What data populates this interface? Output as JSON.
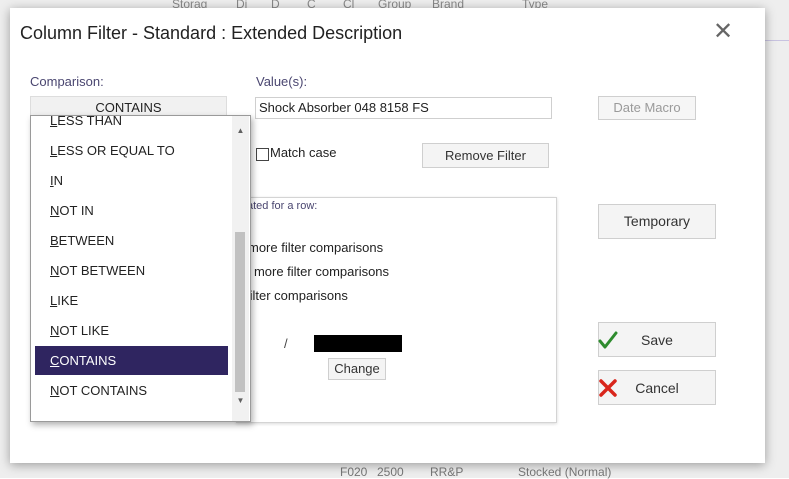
{
  "background": {
    "headers": [
      "Storag",
      "Di",
      "D",
      "C",
      "Cl",
      "Group",
      "Brand",
      "Type"
    ],
    "row": [
      "F020",
      "2500",
      "RR&P",
      "Stocked (Normal)"
    ]
  },
  "dialog": {
    "title": "Column Filter - Standard : Extended Description",
    "close_glyph": "✕"
  },
  "comparison": {
    "label": "Comparison:",
    "selected": "CONTAINS"
  },
  "values": {
    "label": "Value(s):",
    "value": "Shock Absorber 048 8158 FS"
  },
  "buttons": {
    "date_macro": "Date Macro",
    "remove_filter": "Remove Filter",
    "temporary": "Temporary",
    "save": "Save",
    "cancel": "Cancel",
    "change": "Change"
  },
  "match_case": {
    "label": "Match case",
    "checked": false
  },
  "group": {
    "legend": "ated for a row:",
    "options": [
      " more filter comparisons",
      "r more filter comparisons",
      "filter comparisons"
    ],
    "slash": "/"
  },
  "dropdown": {
    "items": [
      {
        "accel": "L",
        "rest": "ESS THAN"
      },
      {
        "accel": "L",
        "rest": "ESS OR EQUAL TO"
      },
      {
        "accel": "I",
        "rest": "N"
      },
      {
        "accel": "N",
        "rest": "OT IN"
      },
      {
        "accel": "B",
        "rest": "ETWEEN"
      },
      {
        "accel": "N",
        "rest": "OT BETWEEN"
      },
      {
        "accel": "L",
        "rest": "IKE"
      },
      {
        "accel": "N",
        "rest": "OT LIKE"
      },
      {
        "accel": "C",
        "rest": "ONTAINS"
      },
      {
        "accel": "N",
        "rest": "OT CONTAINS"
      }
    ],
    "selected_index": 8,
    "scroll_up_glyph": "▲",
    "scroll_down_glyph": "▼"
  },
  "colors": {
    "accent": "#2f2560",
    "label": "#4a4670",
    "save_check": "#2e8b2e",
    "cancel_x": "#d9261c"
  }
}
